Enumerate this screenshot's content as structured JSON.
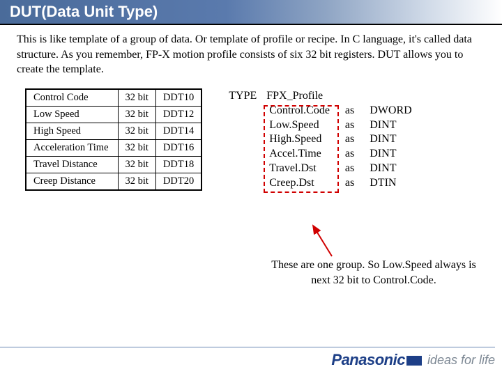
{
  "header": {
    "title": "DUT(Data Unit Type)"
  },
  "intro": "This is like template of a group of data.   Or template of profile or recipe.  In C language, it's called data structure.   As you remember, FP-X motion profile consists of six 32 bit registers.   DUT allows you to create the template.",
  "table": {
    "rows": [
      {
        "name": "Control Code",
        "bits": "32 bit",
        "addr": "DDT10"
      },
      {
        "name": "Low Speed",
        "bits": "32 bit",
        "addr": "DDT12"
      },
      {
        "name": "High Speed",
        "bits": "32 bit",
        "addr": "DDT14"
      },
      {
        "name": "Acceleration Time",
        "bits": "32 bit",
        "addr": "DDT16"
      },
      {
        "name": "Travel Distance",
        "bits": "32 bit",
        "addr": "DDT18"
      },
      {
        "name": "Creep Distance",
        "bits": "32 bit",
        "addr": "DDT20"
      }
    ]
  },
  "type_keyword": "TYPE",
  "struct": {
    "name": "FPX_Profile",
    "fields": [
      {
        "n": "Control.Code",
        "as": "as",
        "t": "DWORD"
      },
      {
        "n": "Low.Speed",
        "as": "as",
        "t": "DINT"
      },
      {
        "n": "High.Speed",
        "as": "as",
        "t": "DINT"
      },
      {
        "n": "Accel.Time",
        "as": "as",
        "t": "DINT"
      },
      {
        "n": "Travel.Dst",
        "as": "as",
        "t": "DINT"
      },
      {
        "n": "Creep.Dst",
        "as": "as",
        "t": "DTIN"
      }
    ]
  },
  "note": "These are one group.  So Low.Speed always is next 32 bit to Control.Code.",
  "footer": {
    "brand": "Panasonic",
    "tagline": "ideas for life"
  }
}
